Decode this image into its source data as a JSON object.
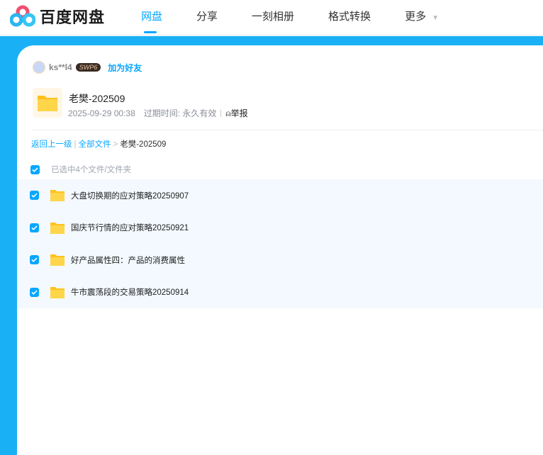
{
  "header": {
    "logo": "百度网盘",
    "nav": [
      "网盘",
      "分享",
      "一刻相册",
      "格式转换",
      "更多"
    ],
    "active": "网盘"
  },
  "share": {
    "user": "ks**l4",
    "badge": "SWP6",
    "add_friend": "加为好友",
    "title": "老樊-202509",
    "date": "2025-09-29 00:38",
    "expire": "过期时间: 永久有效",
    "report": "举报"
  },
  "breadcrumb": {
    "back": "返回上一级",
    "all": "全部文件",
    "current": "老樊-202509"
  },
  "selection": "已选中4个文件/文件夹",
  "files": [
    {
      "name": "大盘切换期的应对策略20250907"
    },
    {
      "name": "国庆节行情的应对策略20250921"
    },
    {
      "name": "好产品属性四：产品的消费属性"
    },
    {
      "name": "牛市震荡段的交易策略20250914"
    }
  ],
  "colors": {
    "accent": "#06a7ff",
    "bg": "#1ab0f5"
  }
}
